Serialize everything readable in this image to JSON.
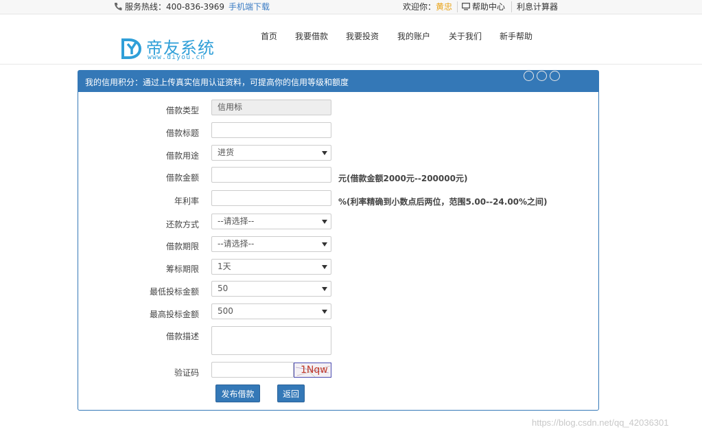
{
  "topbar": {
    "hotline": "服务热线：400-836-3969",
    "app_download": "手机端下载",
    "welcome_prefix": "欢迎你：",
    "username": "黄忠",
    "help_center": "帮助中心",
    "calculator": "利息计算器"
  },
  "logo": {
    "name": "帝友系统",
    "url": "www.diyou.cn",
    "color": "#2f9fd8"
  },
  "nav": [
    "首页",
    "我要借款",
    "我要投资",
    "我的账户",
    "关于我们",
    "新手帮助"
  ],
  "panel": {
    "title": "我的信用积分：通过上传真实信用认证资料，可提高你的信用等级和额度",
    "accent": "#3478b7"
  },
  "form": {
    "loan_type": {
      "label": "借款类型",
      "value": "信用标"
    },
    "loan_title": {
      "label": "借款标题",
      "value": ""
    },
    "loan_purpose": {
      "label": "借款用途",
      "value": "进货"
    },
    "loan_amount": {
      "label": "借款金额",
      "value": "",
      "hint": "元(借款金额2000元--200000元)"
    },
    "annual_rate": {
      "label": "年利率",
      "value": "",
      "hint": "%(利率精确到小数点后两位，范围5.00--24.00%之间)"
    },
    "repay_method": {
      "label": "还款方式",
      "value": "--请选择--"
    },
    "loan_period": {
      "label": "借款期限",
      "value": "--请选择--"
    },
    "raise_period": {
      "label": "筹标期限",
      "value": "1天"
    },
    "min_invest": {
      "label": "最低投标金额",
      "value": "50"
    },
    "max_invest": {
      "label": "最高投标金额",
      "value": "500"
    },
    "description": {
      "label": "借款描述",
      "value": ""
    },
    "captcha": {
      "label": "验证码",
      "code": "1Nqw"
    }
  },
  "buttons": {
    "submit": "发布借款",
    "back": "返回"
  },
  "watermark": "https://blog.csdn.net/qq_42036301"
}
